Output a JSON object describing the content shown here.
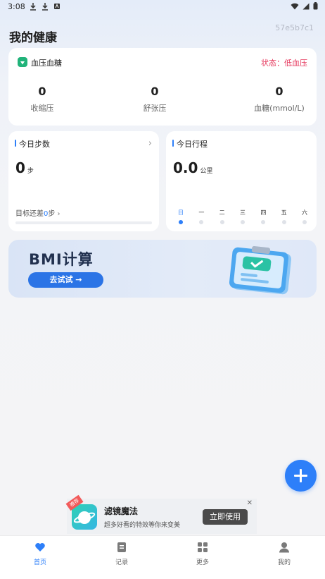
{
  "status_bar": {
    "time": "3:08"
  },
  "header": {
    "title": "我的健康",
    "device_code": "57e5b7c1"
  },
  "blood_card": {
    "title": "血压血糖",
    "status_label": "状态：",
    "status_value": "低血压",
    "items": [
      {
        "value": "0",
        "label": "收缩压"
      },
      {
        "value": "0",
        "label": "舒张压"
      },
      {
        "value": "0",
        "label": "血糖(mmol/L)"
      }
    ]
  },
  "steps_card": {
    "title": "今日步数",
    "value": "0",
    "unit": "步",
    "goal_prefix": "目标还差",
    "goal_value": "0",
    "goal_suffix": "步",
    "progress": 0
  },
  "trip_card": {
    "title": "今日行程",
    "value": "0.0",
    "unit": "公里",
    "days": [
      "日",
      "一",
      "二",
      "三",
      "四",
      "五",
      "六"
    ],
    "active_day": 0
  },
  "bmi_banner": {
    "title": "BMI计算",
    "button": "去试试 →"
  },
  "ad": {
    "tag": "推荐",
    "title": "滤镜魔法",
    "subtitle": "超多好看的特效等你来变美",
    "button": "立即使用",
    "close": "✕"
  },
  "tabbar": [
    {
      "label": "首页",
      "icon": "heart-icon",
      "active": true
    },
    {
      "label": "记录",
      "icon": "record-icon",
      "active": false
    },
    {
      "label": "更多",
      "icon": "grid-icon",
      "active": false
    },
    {
      "label": "我的",
      "icon": "user-icon",
      "active": false
    }
  ],
  "colors": {
    "accent": "#2d7ff9",
    "alert": "#e5365b",
    "bp_icon": "#21b37a"
  }
}
